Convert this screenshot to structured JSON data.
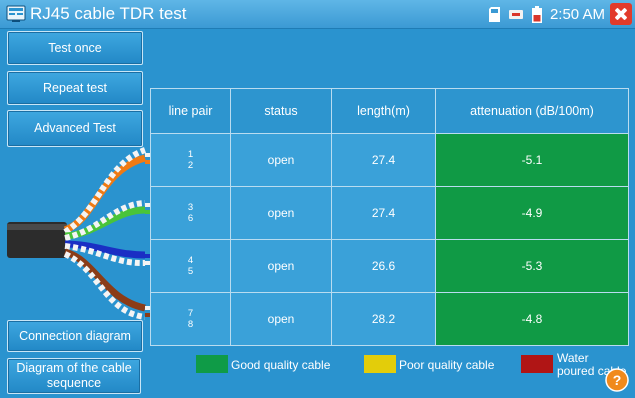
{
  "window": {
    "title": "RJ45 cable TDR test",
    "time": "2:50 AM"
  },
  "buttons": {
    "test_once": "Test once",
    "repeat_test": "Repeat test",
    "advanced_test": "Advanced Test",
    "connection_diagram": "Connection diagram",
    "cable_sequence": "Diagram of the cable sequence"
  },
  "table": {
    "headers": [
      "line pair",
      "status",
      "length(m)",
      "attenuation (dB/100m)"
    ],
    "rows": [
      {
        "pair_a": "1",
        "pair_b": "2",
        "status": "open",
        "length": "27.4",
        "attenuation": "-5.1"
      },
      {
        "pair_a": "3",
        "pair_b": "6",
        "status": "open",
        "length": "27.4",
        "attenuation": "-4.9"
      },
      {
        "pair_a": "4",
        "pair_b": "5",
        "status": "open",
        "length": "26.6",
        "attenuation": "-5.3"
      },
      {
        "pair_a": "7",
        "pair_b": "8",
        "status": "open",
        "length": "28.2",
        "attenuation": "-4.8"
      }
    ]
  },
  "legend": {
    "good": {
      "label": "Good quality cable",
      "color": "#0f9b47"
    },
    "poor": {
      "label": "Poor quality cable",
      "color": "#e3cd0a"
    },
    "water": {
      "label": "Water poured cable",
      "color": "#b01515"
    }
  },
  "colors": {
    "background": "#2a93cf",
    "accent_close": "#e23b2b"
  }
}
